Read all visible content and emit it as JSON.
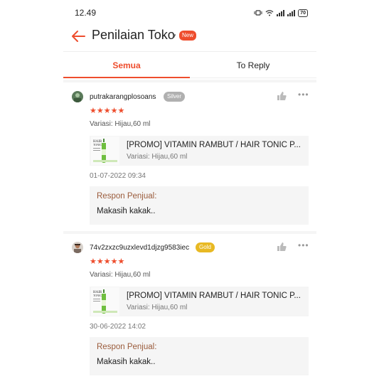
{
  "status_bar": {
    "time": "12.49",
    "battery": "70"
  },
  "header": {
    "title": "Penilaian Toko",
    "badge": "New",
    "icons": [
      "back-arrow-icon",
      "caret-down-icon"
    ]
  },
  "tabs": [
    {
      "label": "Semua",
      "active": true
    },
    {
      "label": "To Reply",
      "active": false
    }
  ],
  "colors": {
    "accent": "#ee4d2d",
    "silver": "#b0b0b0",
    "gold": "#e8b923",
    "response_label": "#9a5b3b"
  },
  "reviews": [
    {
      "username": "putrakarangplosoans",
      "tier": "Silver",
      "rating": 5,
      "stars": "★★★★★",
      "variant": "Variasi: Hijau,60 ml",
      "product_name": "[PROMO] VITAMIN RAMBUT / HAIR TONIC P...",
      "product_variant": "Variasi: Hijau,60 ml",
      "date": "01-07-2022 09:34",
      "response_label": "Respon Penjual:",
      "response_text": "Makasih kakak.."
    },
    {
      "username": "74v2zxzc9uzxlevd1djzg9583iec",
      "tier": "Gold",
      "rating": 5,
      "stars": "★★★★★",
      "variant": "Variasi: Hijau,60 ml",
      "product_name": "[PROMO] VITAMIN RAMBUT / HAIR TONIC P...",
      "product_variant": "Variasi: Hijau,60 ml",
      "date": "30-06-2022 14:02",
      "response_label": "Respon Penjual:",
      "response_text": "Makasih kakak.."
    }
  ]
}
